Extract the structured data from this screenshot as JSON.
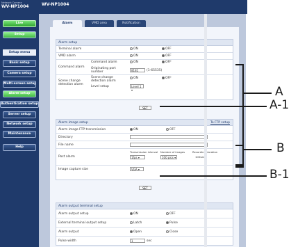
{
  "brand": {
    "small": "Network Camera",
    "model": "WV-NP1004"
  },
  "topbar": {
    "title": "WV-NP1004"
  },
  "sidebar": {
    "live": "Live",
    "setup": "Setup",
    "setup_menu": "Setup menu",
    "items": [
      "Basic setup",
      "Camera setup",
      "Multi-screen setup",
      "Alarm setup",
      "Authentication setup",
      "Server setup",
      "Network setup",
      "Maintenance",
      "Help"
    ]
  },
  "tabs": [
    "Alarm",
    "VMD area",
    "Notification"
  ],
  "alarm_setup": {
    "heading": "Alarm setup",
    "terminal_alarm": "Terminal alarm",
    "vmd_alarm": "VMD alarm",
    "command_alarm": "Command alarm",
    "command_alarm_sub": "Command alarm",
    "originating_port": "Originating port number",
    "port_value": "8181",
    "port_range": "(1-65535)",
    "scene_change": "Scene change detection alarm",
    "scene_change_sub": "Scene change detection alarm",
    "level_setup": "Level setup",
    "level_value": "Level 1",
    "on": "ON",
    "off": "OFF",
    "set": "SET"
  },
  "image_setup": {
    "heading": "Alarm image setup",
    "ftp_link": "To FTP setup",
    "ftp_transmission": "Alarm image FTP transmission",
    "directory": "Directory",
    "file_name": "File name",
    "post_alarm": "Post alarm",
    "transmission_interval": "Transmission interval",
    "interval_value": "1fps",
    "number_of_images": "Number of images",
    "images_value": "100 pics",
    "recording_duration": "Recording duration",
    "duration_value": "100sec",
    "capture_size": "Image capture size",
    "capture_value": "VGA",
    "on": "ON",
    "off": "OFF",
    "set": "SET"
  },
  "output_setup": {
    "heading": "Alarm output terminal setup",
    "output_setup": "Alarm output setup",
    "external_terminal": "External terminal output setup",
    "alarm_output": "Alarm output",
    "pulse_width": "Pulse width",
    "pulse_value": "1",
    "pulse_unit": "sec",
    "on": "ON",
    "off": "OFF",
    "latch": "Latch",
    "pulse": "Pulse",
    "open": "Open",
    "close": "Close"
  },
  "callouts": {
    "a": "A",
    "a1": "A-1",
    "b": "B",
    "b1": "B-1"
  }
}
